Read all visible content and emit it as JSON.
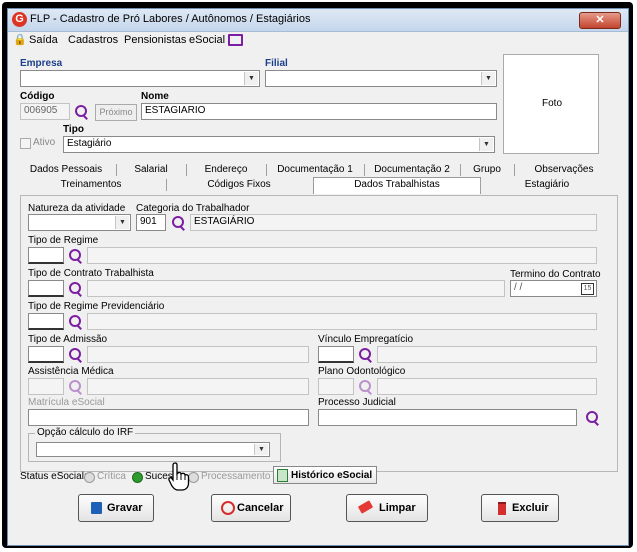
{
  "window": {
    "title": "FLP - Cadastro de Pró Labores / Autônomos / Estagiários",
    "close_label": "✕"
  },
  "menu": {
    "saida": "Saída",
    "cadastros": "Cadastros",
    "pensionistas": "Pensionistas",
    "esocial": "eSocial"
  },
  "header": {
    "empresa_label": "Empresa",
    "empresa_value": "",
    "filial_label": "Filial",
    "filial_value": "",
    "codigo_label": "Código",
    "codigo_value": "006905",
    "proximo_label": "Próximo",
    "nome_label": "Nome",
    "nome_value": "ESTAGIARIO",
    "ativo_label": "Ativo",
    "tipo_label": "Tipo",
    "tipo_value": "Estagiário",
    "foto_label": "Foto"
  },
  "tabs": {
    "row1": [
      "Dados Pessoais",
      "Salarial",
      "Endereço",
      "Documentação 1",
      "Documentação 2",
      "Grupo",
      "Observações"
    ],
    "row2": [
      "Treinamentos",
      "Códigos Fixos",
      "Dados Trabalhistas",
      "Estagiário"
    ],
    "active": "Dados Trabalhistas"
  },
  "form": {
    "natureza_label": "Natureza da atividade",
    "natureza_value": "",
    "categoria_label": "Categoria do Trabalhador",
    "categoria_code": "901",
    "categoria_desc": "ESTAGIÁRIO",
    "regime_label": "Tipo de Regime",
    "contrato_label": "Tipo de Contrato Trabalhista",
    "termino_label": "Termino do Contrato",
    "termino_value": " / /",
    "previdenciario_label": "Tipo de Regime Previdenciário",
    "admissao_label": "Tipo de Admissão",
    "vinculo_label": "Vínculo Empregatício",
    "assistencia_label": "Assistência Médica",
    "odonto_label": "Plano Odontológico",
    "matricula_label": "Matrícula eSocial",
    "processo_label": "Processo Judicial",
    "irf_label": "Opção cálculo do IRF",
    "irf_value": ""
  },
  "status": {
    "label": "Status eSocial:",
    "critica": "Crítica",
    "sucesso": "Suces",
    "processamento": "Processamento",
    "historico": "Histórico eSocial"
  },
  "buttons": {
    "gravar": "Gravar",
    "cancelar": "Cancelar",
    "limpar": "Limpar",
    "excluir": "Excluir"
  },
  "colors": {
    "accent": "#7b1fa2",
    "label_blue": "#1b3f8a",
    "success": "#2e9b2e"
  }
}
